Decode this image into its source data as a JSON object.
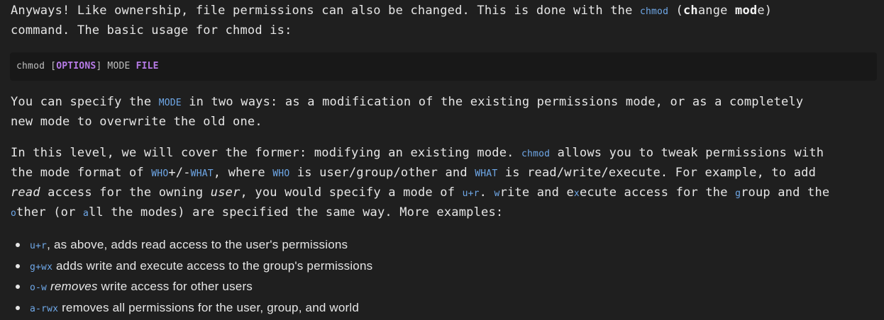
{
  "p1": {
    "t1": "Anyways! Like ownership, file permissions can also be changed. This is done with the ",
    "code": "chmod",
    "t2": " (",
    "b1": "ch",
    "t3": "ange ",
    "b2": "mod",
    "t4": "e)",
    "t5": "command. The basic usage for chmod is:"
  },
  "pre": {
    "a": "chmod [",
    "kw1": "OPTIONS",
    "b": "] MODE ",
    "kw2": "FILE"
  },
  "p2": {
    "t1": "You can specify the ",
    "code": "MODE",
    "t2": " in two ways: as a modification of the existing permissions mode, or as a completely",
    "t3": "new mode to overwrite the old one."
  },
  "p3": {
    "t1": "In this level, we will cover the former: modifying an existing mode. ",
    "c1": "chmod",
    "t2": " allows you to tweak permissions with",
    "t3": "the mode format of ",
    "c2": "WHO",
    "t4": "+/-",
    "c3": "WHAT",
    "t5": ", where ",
    "c4": "WHO",
    "t6": " is user/group/other and ",
    "c5": "WHAT",
    "t7": " is read/write/execute. For example, to add",
    "i1": "read",
    "t8": " access for the owning ",
    "i2": "user",
    "t9": ", you would specify a mode of ",
    "c6": "u+r",
    "t10": ". ",
    "c7": "w",
    "t11": "rite and e",
    "c8": "x",
    "t12": "ecute access for the ",
    "c9": "g",
    "t13": "roup and the",
    "c10": "o",
    "t14": "ther (or ",
    "c11": "a",
    "t15": "ll the modes) are specified the same way. More examples:"
  },
  "list": [
    {
      "code": "u+r",
      "pre": "",
      "text": ", as above, adds read access to the user's permissions"
    },
    {
      "code": "g+wx",
      "pre": "",
      "text": " adds write and execute access to the group's permissions"
    },
    {
      "code": "o-w",
      "pre": " ",
      "em": "removes",
      "text": " write access for other users"
    },
    {
      "code": "a-rwx",
      "pre": "",
      "text": " removes all permissions for the user, group, and world"
    }
  ],
  "colors": {
    "code": "#6fa8e8",
    "keyword": "#b77be8",
    "text": "#e6e6e6",
    "background": "#1f1f1f"
  }
}
